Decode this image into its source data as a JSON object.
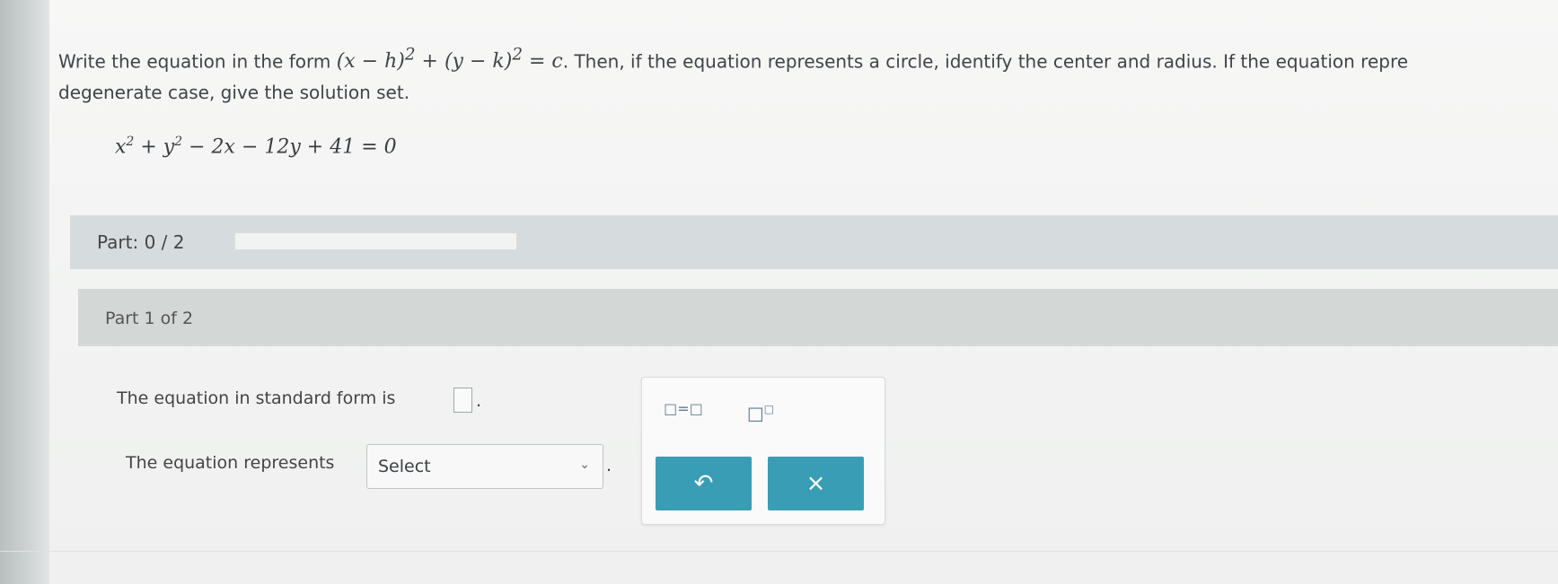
{
  "prompt": {
    "line1_start": "Write the equation in the form ",
    "form": "(x − h)",
    "form_mid": " + (y − k)",
    "form_end": " = c",
    "line1_rest": ". Then, if the equation represents a circle, identify the center and radius. If the equation repre",
    "line2": "degenerate case, give the solution set."
  },
  "equation": {
    "display_a": "x",
    "display_b": " + y",
    "display_c": " − 2x − 12y + 41 = 0",
    "exponent": "2"
  },
  "progress": {
    "label": "Part: 0 / 2",
    "fraction": 0
  },
  "part": {
    "title": "Part 1 of 2"
  },
  "question1": {
    "text": "The equation in standard form is",
    "period": "."
  },
  "question2": {
    "text": "The equation represents",
    "select_value": "Select",
    "period": "."
  },
  "tools": {
    "eq_template": "□=□",
    "sup_template": "□",
    "sup_box": "□",
    "undo_icon": "↶",
    "clear_icon": "×"
  }
}
